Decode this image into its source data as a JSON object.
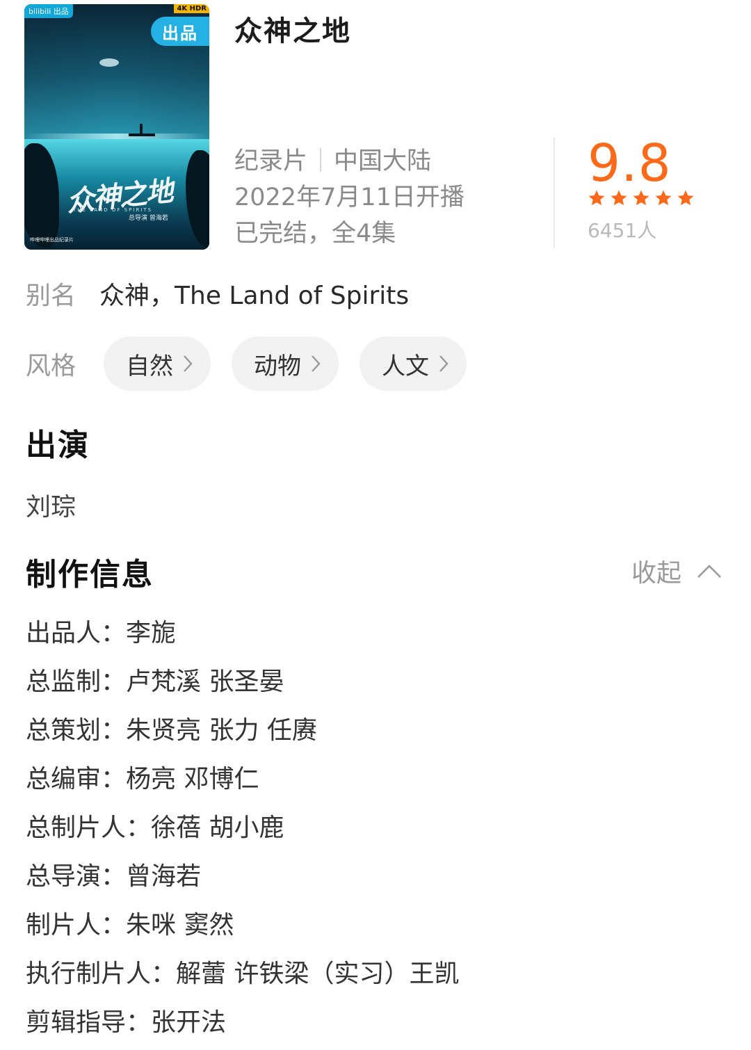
{
  "poster": {
    "badge_top": "bilibili 出品",
    "badge_4k": "4K HDR",
    "badge_out": "出品",
    "calligraphy": "众神之地",
    "subtitle_en": "THE LAND OF SPIRITS",
    "director_mark": "总导演 曾海若",
    "footer_mark": "哔哩哔哩出品纪录片"
  },
  "title": "众神之地",
  "meta": {
    "genre": "纪录片",
    "region": "中国大陆",
    "premiere": "2022年7月11日开播",
    "status": "已完结，全4集"
  },
  "rating": {
    "score": "9.8",
    "stars": 5,
    "count": "6451人",
    "accent_color": "#ff6a1a"
  },
  "alias": {
    "label": "别名",
    "value": "众神，The Land of Spirits"
  },
  "styles": {
    "label": "风格",
    "chips": [
      "自然",
      "动物",
      "人文"
    ]
  },
  "cast": {
    "heading": "出演",
    "names": "刘琮"
  },
  "production": {
    "heading": "制作信息",
    "collapse_label": "收起",
    "credits": [
      "出品人：李旎",
      "总监制：卢梵溪  张圣晏",
      "总策划：朱贤亮  张力 任赓",
      "总编审：杨亮 邓博仁",
      "总制片人：徐蓓 胡小鹿",
      "总导演：曾海若",
      "制片人：朱咪 窦然",
      "执行制片人：解蕾  许铁梁（实习）王凯",
      "剪辑指导：张开法"
    ]
  }
}
